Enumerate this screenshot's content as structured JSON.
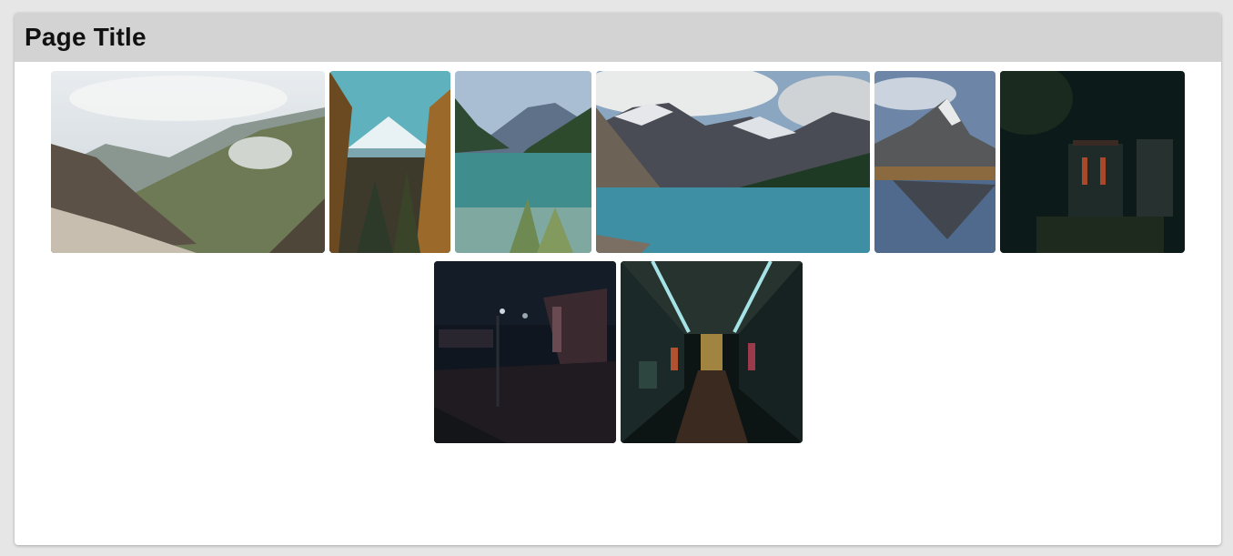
{
  "page": {
    "title": "Page Title"
  },
  "gallery": {
    "photos": [
      {
        "subject": "mountain-valley-clouds"
      },
      {
        "subject": "snowy-peak-forest"
      },
      {
        "subject": "lake-mountains-grass"
      },
      {
        "subject": "moraine-lake"
      },
      {
        "subject": "matterhorn-reflection"
      },
      {
        "subject": "forest-shrine"
      },
      {
        "subject": "night-street"
      },
      {
        "subject": "shopping-arcade-night"
      }
    ]
  }
}
